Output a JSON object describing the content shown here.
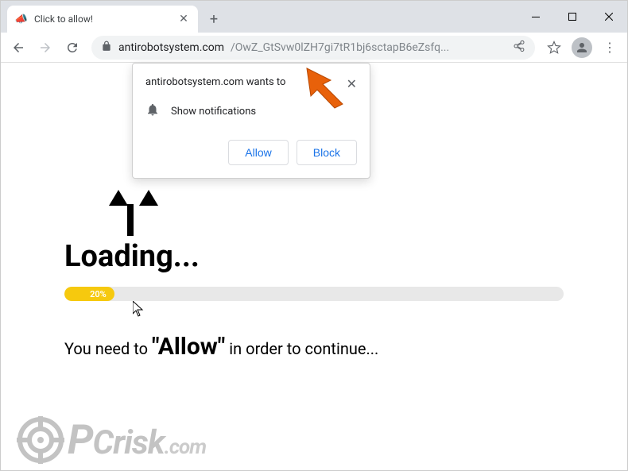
{
  "tab": {
    "title": "Click to allow!",
    "favicon": "📣"
  },
  "toolbar": {
    "url_domain": "antirobotsystem.com",
    "url_path": "/OwZ_GtSvw0lZH7gi7tR1bj6sctapB6eZsfq..."
  },
  "notification": {
    "site_wants": "antirobotsystem.com wants to",
    "show_notifications": "Show notifications",
    "allow_label": "Allow",
    "block_label": "Block"
  },
  "page": {
    "loading_title": "Loading...",
    "progress_percent": "20%",
    "instruction_prefix": "You need to ",
    "instruction_allow": "\"Allow\"",
    "instruction_suffix": " in order to continue..."
  },
  "watermark": {
    "brand_p": "P",
    "brand_rest": "Crisk",
    "domain": ".com"
  }
}
